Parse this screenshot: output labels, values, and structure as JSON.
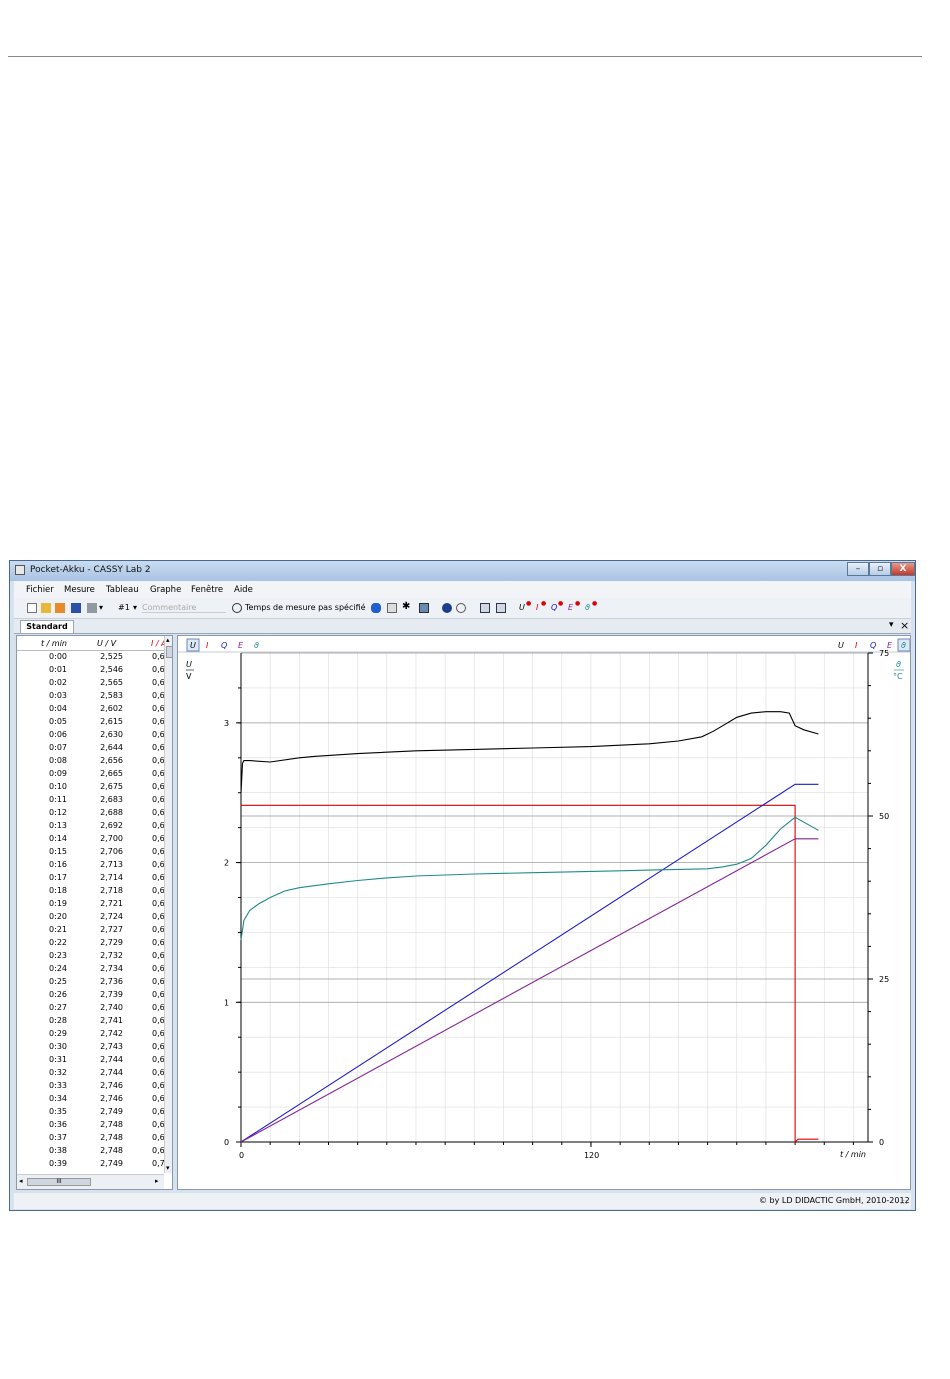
{
  "window": {
    "title": "Pocket-Akku - CASSY Lab 2",
    "close_glyph": "X"
  },
  "menu": [
    "Fichier",
    "Mesure",
    "Tableau",
    "Graphe",
    "Fenêtre",
    "Aide"
  ],
  "toolbar": {
    "channel": "#1",
    "comment_placeholder": "Commentaire",
    "measure_time": "Temps de mesure pas spécifié",
    "icons": [
      "new-file-icon",
      "open-folder-icon",
      "open-example-icon",
      "save-icon",
      "print-icon",
      "stopwatch-icon",
      "bluetooth-icon",
      "cassy-module-icon",
      "settings-gear-icon",
      "display-icon",
      "help-icon",
      "update-icon",
      "window-tile-icon",
      "window-cascade-icon"
    ],
    "quantity_buttons": [
      "U",
      "I",
      "Q",
      "E",
      "ϑ"
    ]
  },
  "tab": {
    "label": "Standard"
  },
  "table": {
    "columns": [
      "t / min",
      "U / V",
      "I / A"
    ],
    "rows": [
      [
        "0:00",
        "2,525",
        "0,6"
      ],
      [
        "0:01",
        "2,546",
        "0,6"
      ],
      [
        "0:02",
        "2,565",
        "0,6"
      ],
      [
        "0:03",
        "2,583",
        "0,6"
      ],
      [
        "0:04",
        "2,602",
        "0,6"
      ],
      [
        "0:05",
        "2,615",
        "0,6"
      ],
      [
        "0:06",
        "2,630",
        "0,6"
      ],
      [
        "0:07",
        "2,644",
        "0,6"
      ],
      [
        "0:08",
        "2,656",
        "0,6"
      ],
      [
        "0:09",
        "2,665",
        "0,6"
      ],
      [
        "0:10",
        "2,675",
        "0,6"
      ],
      [
        "0:11",
        "2,683",
        "0,6"
      ],
      [
        "0:12",
        "2,688",
        "0,6"
      ],
      [
        "0:13",
        "2,692",
        "0,6"
      ],
      [
        "0:14",
        "2,700",
        "0,6"
      ],
      [
        "0:15",
        "2,706",
        "0,6"
      ],
      [
        "0:16",
        "2,713",
        "0,6"
      ],
      [
        "0:17",
        "2,714",
        "0,6"
      ],
      [
        "0:18",
        "2,718",
        "0,6"
      ],
      [
        "0:19",
        "2,721",
        "0,6"
      ],
      [
        "0:20",
        "2,724",
        "0,6"
      ],
      [
        "0:21",
        "2,727",
        "0,6"
      ],
      [
        "0:22",
        "2,729",
        "0,6"
      ],
      [
        "0:23",
        "2,732",
        "0,6"
      ],
      [
        "0:24",
        "2,734",
        "0,6"
      ],
      [
        "0:25",
        "2,736",
        "0,6"
      ],
      [
        "0:26",
        "2,739",
        "0,6"
      ],
      [
        "0:27",
        "2,740",
        "0,6"
      ],
      [
        "0:28",
        "2,741",
        "0,6"
      ],
      [
        "0:29",
        "2,742",
        "0,6"
      ],
      [
        "0:30",
        "2,743",
        "0,6"
      ],
      [
        "0:31",
        "2,744",
        "0,6"
      ],
      [
        "0:32",
        "2,744",
        "0,6"
      ],
      [
        "0:33",
        "2,746",
        "0,6"
      ],
      [
        "0:34",
        "2,746",
        "0,6"
      ],
      [
        "0:35",
        "2,749",
        "0,6"
      ],
      [
        "0:36",
        "2,748",
        "0,6"
      ],
      [
        "0:37",
        "2,748",
        "0,6"
      ],
      [
        "0:38",
        "2,748",
        "0,6"
      ],
      [
        "0:39",
        "2,749",
        "0,7"
      ]
    ]
  },
  "graph": {
    "left_buttons": [
      "U",
      "I",
      "Q",
      "E",
      "ϑ"
    ],
    "right_buttons": [
      "U",
      "I",
      "Q",
      "E",
      "ϑ"
    ],
    "y_left_label": "U",
    "y_left_unit": "V",
    "y_right_label": "ϑ",
    "y_right_unit": "°C",
    "x_label": "t / min"
  },
  "chart_data": {
    "type": "line",
    "x_ticks": [
      0,
      120
    ],
    "xlim": [
      0,
      215
    ],
    "y_left_ticks": [
      0,
      1,
      2,
      3
    ],
    "ylim_left": [
      0,
      3.5
    ],
    "y_right_ticks": [
      0,
      25,
      50,
      75
    ],
    "ylim_right": [
      0,
      75
    ],
    "grid": true,
    "series": [
      {
        "color": "#000000",
        "axis": "left",
        "x": [
          0,
          0.5,
          1,
          3,
          10,
          20,
          25,
          40,
          60,
          80,
          100,
          120,
          130,
          140,
          150,
          158,
          162,
          166,
          170,
          175,
          180,
          185,
          188,
          190,
          193,
          198
        ],
        "y": [
          2.5,
          2.71,
          2.73,
          2.73,
          2.72,
          2.75,
          2.76,
          2.78,
          2.8,
          2.81,
          2.82,
          2.83,
          2.84,
          2.85,
          2.87,
          2.9,
          2.94,
          2.99,
          3.04,
          3.07,
          3.08,
          3.08,
          3.07,
          2.98,
          2.95,
          2.92
        ]
      },
      {
        "color": "#dd0000",
        "axis": "left",
        "x": [
          0,
          190,
          190,
          191,
          198
        ],
        "y": [
          2.41,
          2.41,
          0.0,
          0.02,
          0.02
        ]
      },
      {
        "color": "#1a1acc",
        "axis": "left",
        "x": [
          0,
          190,
          198
        ],
        "y": [
          0.0,
          2.56,
          2.56
        ]
      },
      {
        "color": "#882299",
        "axis": "left",
        "x": [
          0,
          190,
          198
        ],
        "y": [
          0.0,
          2.17,
          2.17
        ]
      },
      {
        "color": "#1f8a8a",
        "axis": "right",
        "x": [
          0,
          1,
          3,
          6,
          10,
          15,
          20,
          30,
          40,
          50,
          60,
          80,
          100,
          120,
          140,
          160,
          165,
          170,
          175,
          180,
          185,
          190,
          194,
          198
        ],
        "y": [
          31,
          34,
          35.5,
          36.5,
          37.5,
          38.5,
          39,
          39.6,
          40.1,
          40.5,
          40.8,
          41.1,
          41.3,
          41.5,
          41.7,
          41.9,
          42.2,
          42.6,
          43.5,
          45.5,
          48,
          49.8,
          48.8,
          47.8
        ]
      }
    ]
  },
  "status": {
    "copyright": "©  by LD DIDACTIC GmbH, 2010-2012"
  }
}
